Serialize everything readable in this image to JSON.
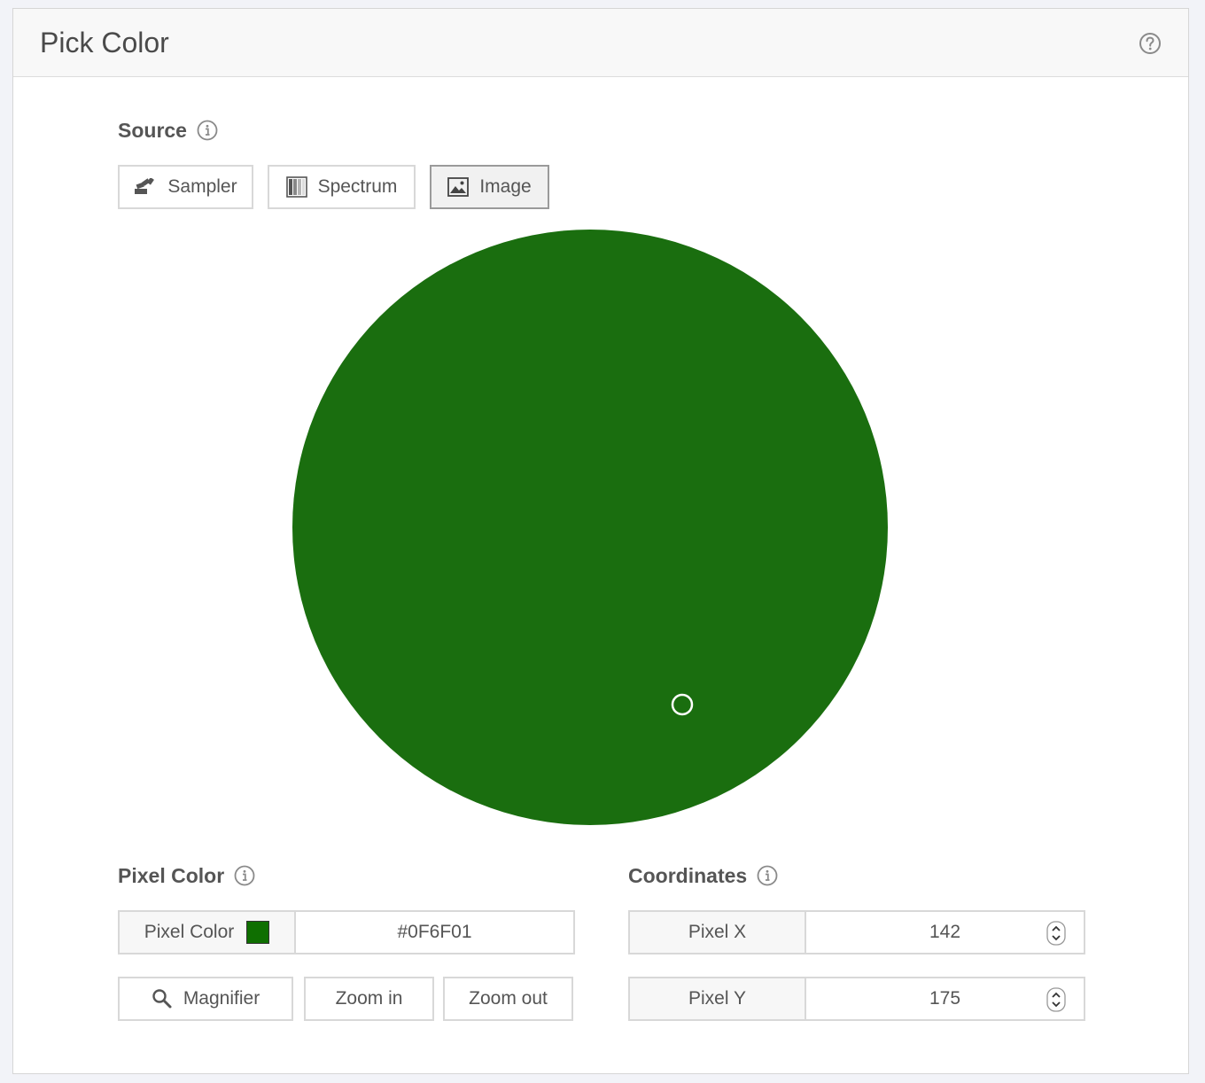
{
  "panel": {
    "title": "Pick Color"
  },
  "source": {
    "label": "Source",
    "buttons": [
      {
        "label": "Sampler",
        "icon": "sampler-icon",
        "active": false
      },
      {
        "label": "Spectrum",
        "icon": "spectrum-icon",
        "active": false
      },
      {
        "label": "Image",
        "icon": "image-icon",
        "active": true
      }
    ]
  },
  "image": {
    "fill_color": "#1a6e0f",
    "cursor_color": "#ffffff"
  },
  "pixel_color": {
    "section_label": "Pixel Color",
    "field_label": "Pixel Color",
    "swatch_color": "#0F6F01",
    "value": "#0F6F01",
    "buttons": {
      "magnifier": "Magnifier",
      "zoom_in": "Zoom in",
      "zoom_out": "Zoom out"
    }
  },
  "coordinates": {
    "section_label": "Coordinates",
    "x": {
      "label": "Pixel X",
      "value": "142"
    },
    "y": {
      "label": "Pixel Y",
      "value": "175"
    }
  }
}
